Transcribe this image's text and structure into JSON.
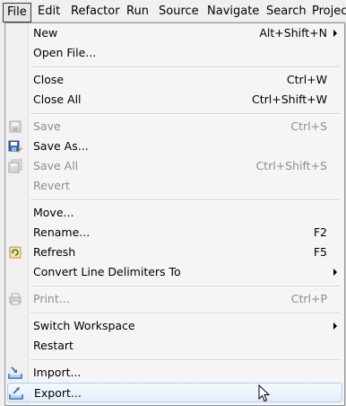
{
  "menubar": {
    "items": [
      "File",
      "Edit",
      "Refactor",
      "Run",
      "Source",
      "Navigate",
      "Search",
      "Projec"
    ]
  },
  "menu": {
    "new": {
      "label": "New",
      "shortcut": "Alt+Shift+N"
    },
    "open_file": {
      "label": "Open File..."
    },
    "close": {
      "label": "Close",
      "shortcut": "Ctrl+W"
    },
    "close_all": {
      "label": "Close All",
      "shortcut": "Ctrl+Shift+W"
    },
    "save": {
      "label": "Save",
      "shortcut": "Ctrl+S"
    },
    "save_as": {
      "label": "Save As..."
    },
    "save_all": {
      "label": "Save All",
      "shortcut": "Ctrl+Shift+S"
    },
    "revert": {
      "label": "Revert"
    },
    "move": {
      "label": "Move..."
    },
    "rename": {
      "label": "Rename...",
      "shortcut": "F2"
    },
    "refresh": {
      "label": "Refresh",
      "shortcut": "F5"
    },
    "convert": {
      "label": "Convert Line Delimiters To"
    },
    "print": {
      "label": "Print...",
      "shortcut": "Ctrl+P"
    },
    "switch_workspace": {
      "label": "Switch Workspace"
    },
    "restart": {
      "label": "Restart"
    },
    "import": {
      "label": "Import..."
    },
    "export": {
      "label": "Export..."
    }
  },
  "colors": {
    "menu_bg": "#f5f5f5",
    "disabled_text": "#8d8d8d",
    "hover_border": "#aecff3"
  }
}
